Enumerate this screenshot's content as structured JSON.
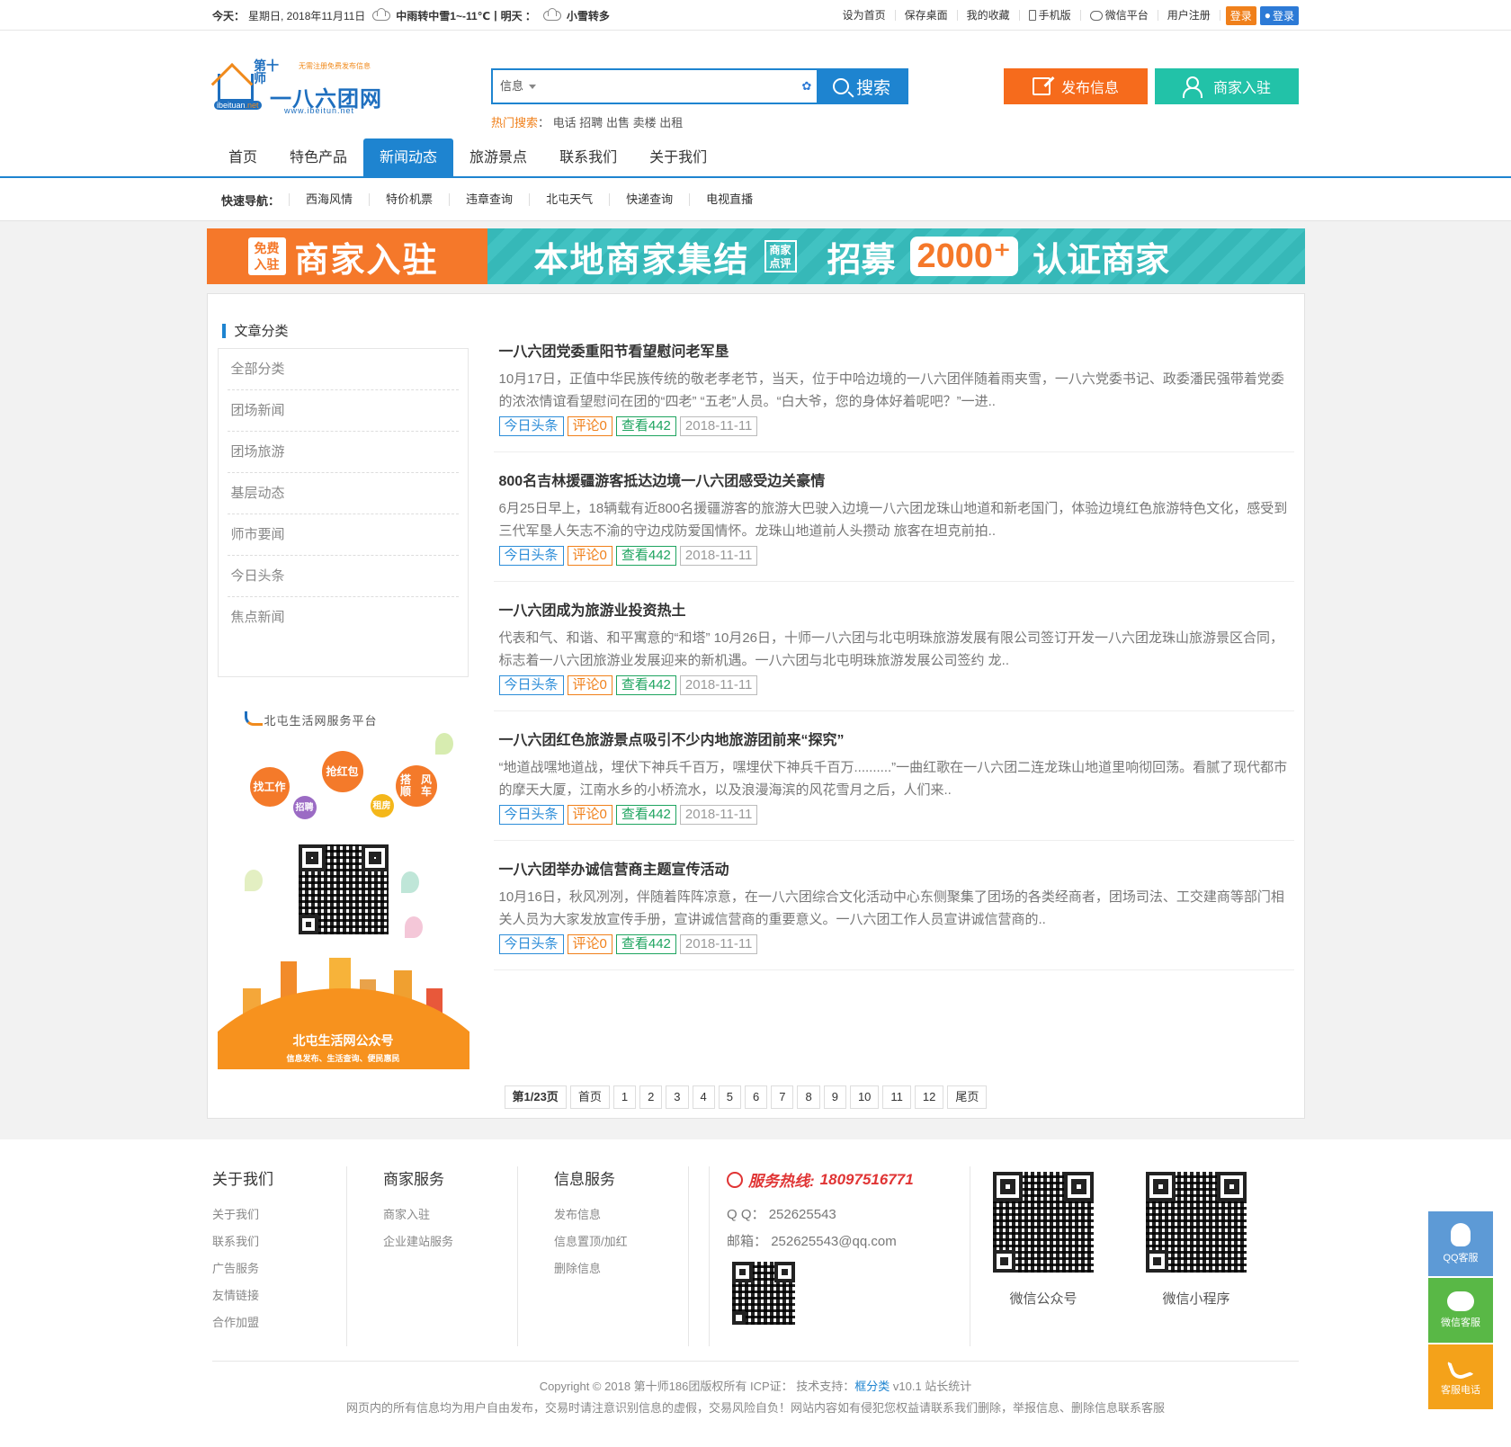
{
  "topbar": {
    "today_label": "今天：",
    "date": "星期日, 2018年11月11日",
    "weather_today": "中雨转中雪1~-11℃",
    "sep": "|",
    "tomorrow_label": "明天 ：",
    "weather_tomorrow": "小雪转多",
    "links": [
      "设为首页",
      "保存桌面",
      "我的收藏",
      "手机版",
      "微信平台",
      "用户注册"
    ],
    "login": "登录",
    "qq_login": "登录"
  },
  "logo": {
    "line1a": "第十",
    "line1b": "师",
    "name": "一八六团网",
    "slogan": "无需注册免费发布信息",
    "badge_a": "ibeituan",
    "badge_b": ".net",
    "url": "www.ibeitun.net"
  },
  "search": {
    "select": "信息",
    "placeholder": "",
    "button": "搜索",
    "hot_label": "热门搜索",
    "hot_colon": "：",
    "hot_words": [
      "电话",
      "招聘",
      "出售",
      "卖楼",
      "出租"
    ]
  },
  "header_buttons": {
    "publish": "发布信息",
    "merchant": "商家入驻"
  },
  "nav": [
    "首页",
    "特色产品",
    "新闻动态",
    "旅游景点",
    "联系我们",
    "关于我们"
  ],
  "quick": {
    "title": "快速导航：",
    "items": [
      "西海风情",
      "特价机票",
      "违章查询",
      "北屯天气",
      "快递查询",
      "电视直播"
    ]
  },
  "banner": {
    "free_a": "免费",
    "free_b": "入驻",
    "t1": "商家入驻",
    "t2": "本地商家集结",
    "stamp_a": "商家",
    "stamp_b": "点评",
    "t3": "招募",
    "num": "2000⁺",
    "t4": "认证商家"
  },
  "sidebar": {
    "title": "文章分类",
    "categories": [
      "全部分类",
      "团场新闻",
      "团场旅游",
      "基层动态",
      "师市要闻",
      "今日头条",
      "焦点新闻"
    ]
  },
  "poster": {
    "title": "北屯生活网服务平台",
    "b1": "找工作",
    "b2": "招聘",
    "b3a": "抢红",
    "b3b": "包",
    "b4": "租房",
    "b5a": "搭顺",
    "b5b": "风车",
    "footer_title": "北屯生活网公众号",
    "footer_sub": "信息发布、生活查询、便民惠民"
  },
  "articles": [
    {
      "title": "一八六团党委重阳节看望慰问老军垦",
      "desc": "10月17日，正值中华民族传统的敬老孝老节，当天，位于中哈边境的一八六团伴随着雨夹雪，一八六党委书记、政委潘民强带着党委的浓浓情谊看望慰问在团的“四老” “五老”人员。“白大爷，您的身体好着呢吧？”一进..",
      "tag": "今日头条",
      "comments": "评论0",
      "views": "查看442",
      "date": "2018-11-11"
    },
    {
      "title": "800名吉林援疆游客抵达边境一八六团感受边关豪情",
      "desc": "6月25日早上，18辆载有近800名援疆游客的旅游大巴驶入边境一八六团龙珠山地道和新老国门，体验边境红色旅游特色文化，感受到三代军垦人矢志不渝的守边戍防爱国情怀。龙珠山地道前人头攒动 旅客在坦克前拍..",
      "tag": "今日头条",
      "comments": "评论0",
      "views": "查看442",
      "date": "2018-11-11"
    },
    {
      "title": "一八六团成为旅游业投资热土",
      "desc": "代表和气、和谐、和平寓意的“和塔” 10月26日，十师一八六团与北屯明珠旅游发展有限公司签订开发一八六团龙珠山旅游景区合同，标志着一八六团旅游业发展迎来的新机遇。一八六团与北屯明珠旅游发展公司签约 龙..",
      "tag": "今日头条",
      "comments": "评论0",
      "views": "查看442",
      "date": "2018-11-11"
    },
    {
      "title": "一八六团红色旅游景点吸引不少内地旅游团前来“探究”",
      "desc": "“地道战嘿地道战，埋伏下神兵千百万，嘿埋伏下神兵千百万..........”一曲红歌在一八六团二连龙珠山地道里响彻回荡。看腻了现代都市的摩天大厦，江南水乡的小桥流水，以及浪漫海滨的风花雪月之后，人们来..",
      "tag": "今日头条",
      "comments": "评论0",
      "views": "查看442",
      "date": "2018-11-11"
    },
    {
      "title": "一八六团举办诚信营商主题宣传活动",
      "desc": "10月16日，秋风冽冽，伴随着阵阵凉意，在一八六团综合文化活动中心东侧聚集了团场的各类经商者，团场司法、工交建商等部门相关人员为大家发放宣传手册，宣讲诚信营商的重要意义。一八六团工作人员宣讲诚信营商的..",
      "tag": "今日头条",
      "comments": "评论0",
      "views": "查看442",
      "date": "2018-11-11"
    }
  ],
  "pager": {
    "current": "第1/23页",
    "first": "首页",
    "pages": [
      "1",
      "2",
      "3",
      "4",
      "5",
      "6",
      "7",
      "8",
      "9",
      "10",
      "11",
      "12"
    ],
    "last": "尾页"
  },
  "footer": {
    "cols": [
      {
        "title": "关于我们",
        "links": [
          "关于我们",
          "联系我们",
          "广告服务",
          "友情链接",
          "合作加盟"
        ]
      },
      {
        "title": "商家服务",
        "links": [
          "商家入驻",
          "企业建站服务"
        ]
      },
      {
        "title": "信息服务",
        "links": [
          "发布信息",
          "信息置顶/加红",
          "删除信息"
        ]
      }
    ],
    "hotline_label": "服务热线:",
    "hotline": "18097516771",
    "qq_label": "Q Q：",
    "qq": "252625543",
    "mail_label": "邮箱：",
    "mail": "252625543@qq.com",
    "qr1_label": "微信公众号",
    "qr2_label": "微信小程序",
    "copyright": "Copyright © 2018 第十师186团版权所有 ICP证： 技术支持：",
    "tech": "框分类",
    "version": " v10.1 站长统计",
    "disclaimer": "网页内的所有信息均为用户自由发布，交易时请注意识别信息的虚假，交易风险自负！网站内容如有侵犯您权益请联系我们删除，举报信息、删除信息联系客服"
  },
  "float": {
    "qq": "QQ客服",
    "wechat": "微信客服",
    "tel": "客服电话"
  },
  "colors": {
    "primary": "#1e84d0",
    "orange": "#f66b1c",
    "teal": "#22c2a8"
  }
}
